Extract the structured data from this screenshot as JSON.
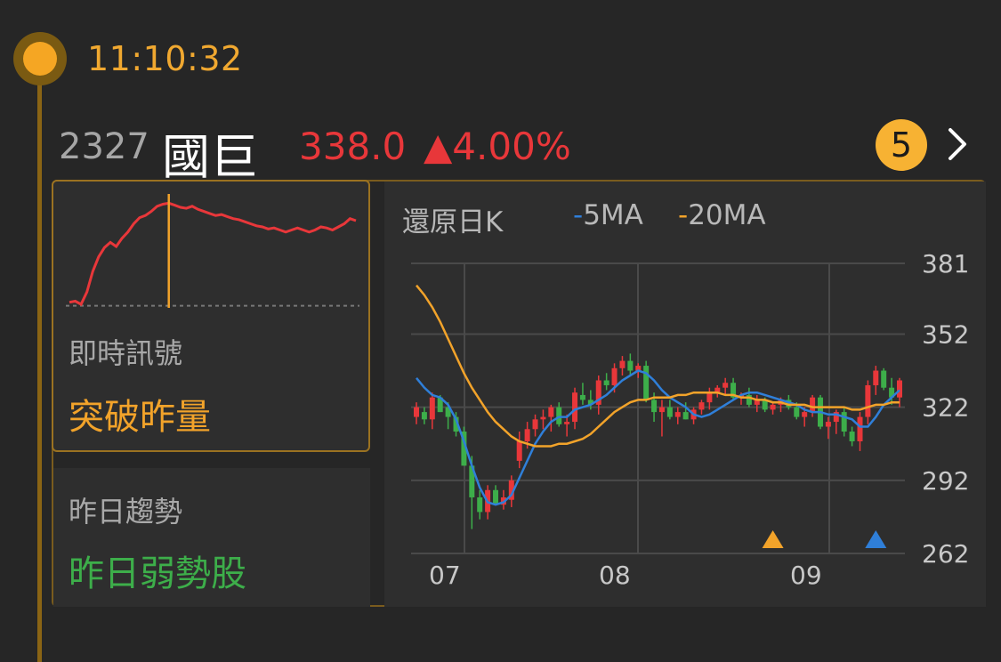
{
  "alert": {
    "time": "11:10:32"
  },
  "stock": {
    "code": "2327",
    "name": "國巨",
    "price": "338.0",
    "change": "▲4.00%",
    "badge_count": "5"
  },
  "signal": {
    "label": "即時訊號",
    "value": "突破昨量"
  },
  "trend": {
    "label": "昨日趨勢",
    "value": "昨日弱勢股"
  },
  "kchart": {
    "title": "還原日K",
    "ma5_label": "5MA",
    "ma20_label": "20MA",
    "dash": "-"
  },
  "colors": {
    "accent": "#f2a32a",
    "up": "#e8373a",
    "down": "#3dae4a",
    "ma5": "#2f7fd9",
    "ma20": "#f2a32a",
    "marker_blue": "#2f7fd9"
  },
  "chart_data": [
    {
      "type": "line",
      "name": "intraday",
      "x": [
        0,
        1,
        2,
        3,
        4,
        5,
        6,
        7,
        8,
        9,
        10,
        11,
        12,
        13,
        14,
        15,
        16,
        17,
        18,
        19,
        20,
        21,
        22,
        23,
        24,
        25,
        26,
        27,
        28,
        29,
        30,
        31,
        32,
        33,
        34,
        35,
        36,
        37,
        38,
        39,
        40,
        41,
        42,
        43,
        44,
        45,
        46,
        47,
        48,
        49
      ],
      "values": [
        0.02,
        0.03,
        0.0,
        0.12,
        0.32,
        0.46,
        0.55,
        0.6,
        0.56,
        0.64,
        0.7,
        0.78,
        0.84,
        0.86,
        0.9,
        0.95,
        0.97,
        0.98,
        0.96,
        0.94,
        0.93,
        0.95,
        0.92,
        0.9,
        0.88,
        0.86,
        0.87,
        0.85,
        0.83,
        0.82,
        0.8,
        0.78,
        0.76,
        0.75,
        0.73,
        0.74,
        0.72,
        0.7,
        0.72,
        0.74,
        0.72,
        0.7,
        0.72,
        0.75,
        0.74,
        0.72,
        0.75,
        0.78,
        0.83,
        0.81
      ],
      "reference_value": 0.02,
      "marker_index": 17
    },
    {
      "type": "candlestick",
      "title": "還原日K",
      "categories": [
        "07",
        "08",
        "09"
      ],
      "ylim": [
        262,
        381
      ],
      "yticks": [
        381,
        352,
        322,
        292,
        262
      ],
      "series": [
        {
          "name": "candles",
          "ohlc": [
            [
              318,
              324,
              315,
              322
            ],
            [
              320,
              322,
              315,
              317
            ],
            [
              317,
              328,
              313,
              326
            ],
            [
              326,
              327,
              320,
              320
            ],
            [
              322,
              324,
              313,
              318
            ],
            [
              318,
              320,
              310,
              312
            ],
            [
              312,
              314,
              298,
              298
            ],
            [
              298,
              302,
              272,
              285
            ],
            [
              285,
              288,
              276,
              279
            ],
            [
              279,
              290,
              276,
              288
            ],
            [
              288,
              290,
              282,
              282
            ],
            [
              282,
              288,
              280,
              285
            ],
            [
              284,
              294,
              281,
              292
            ],
            [
              300,
              312,
              297,
              308
            ],
            [
              308,
              316,
              305,
              313
            ],
            [
              313,
              319,
              310,
              317
            ],
            [
              317,
              321,
              313,
              318
            ],
            [
              318,
              323,
              312,
              322
            ],
            [
              322,
              324,
              314,
              315
            ],
            [
              315,
              319,
              310,
              316
            ],
            [
              316,
              330,
              313,
              328
            ],
            [
              327,
              332,
              323,
              325
            ],
            [
              325,
              329,
              321,
              323
            ],
            [
              323,
              335,
              319,
              333
            ],
            [
              333,
              336,
              329,
              331
            ],
            [
              331,
              340,
              328,
              338
            ],
            [
              338,
              343,
              335,
              341
            ],
            [
              341,
              344,
              335,
              337
            ],
            [
              337,
              340,
              334,
              339
            ],
            [
              339,
              341,
              324,
              325
            ],
            [
              325,
              328,
              316,
              320
            ],
            [
              320,
              325,
              310,
              322
            ],
            [
              322,
              325,
              317,
              318
            ],
            [
              318,
              322,
              315,
              320
            ],
            [
              320,
              324,
              317,
              317
            ],
            [
              317,
              322,
              315,
              321
            ],
            [
              321,
              325,
              319,
              324
            ],
            [
              324,
              330,
              321,
              328
            ],
            [
              328,
              331,
              326,
              330
            ],
            [
              330,
              334,
              327,
              332
            ],
            [
              332,
              334,
              325,
              326
            ],
            [
              326,
              328,
              323,
              327
            ],
            [
              327,
              330,
              322,
              323
            ],
            [
              323,
              327,
              320,
              325
            ],
            [
              325,
              326,
              320,
              321
            ],
            [
              321,
              324,
              319,
              323
            ],
            [
              323,
              326,
              320,
              325
            ],
            [
              325,
              327,
              321,
              322
            ],
            [
              322,
              324,
              317,
              318
            ],
            [
              318,
              322,
              314,
              320
            ],
            [
              320,
              327,
              318,
              326
            ],
            [
              326,
              327,
              313,
              314
            ],
            [
              314,
              318,
              309,
              316
            ],
            [
              316,
              321,
              311,
              320
            ],
            [
              320,
              322,
              310,
              312
            ],
            [
              312,
              314,
              306,
              308
            ],
            [
              308,
              320,
              304,
              318
            ],
            [
              318,
              333,
              315,
              331
            ],
            [
              331,
              339,
              327,
              337
            ],
            [
              337,
              338,
              329,
              330
            ],
            [
              330,
              334,
              323,
              326
            ],
            [
              326,
              334,
              322,
              333
            ]
          ]
        },
        {
          "name": "5MA",
          "values": [
            334,
            330,
            327,
            326,
            323,
            317,
            308,
            298,
            289,
            283,
            282,
            283,
            286,
            293,
            300,
            307,
            312,
            316,
            318,
            318,
            321,
            322,
            323,
            325,
            327,
            330,
            333,
            335,
            337,
            336,
            333,
            329,
            326,
            324,
            322,
            319,
            318,
            319,
            321,
            323,
            325,
            327,
            328,
            328,
            327,
            326,
            325,
            324,
            323,
            321,
            320,
            320,
            319,
            319,
            318,
            317,
            314,
            314,
            318,
            323,
            326,
            329
          ]
        },
        {
          "name": "20MA",
          "values": [
            372,
            368,
            363,
            357,
            350,
            343,
            336,
            330,
            325,
            320,
            316,
            313,
            310,
            308,
            307,
            306,
            306,
            306,
            307,
            307,
            308,
            309,
            311,
            314,
            317,
            320,
            322,
            324,
            325,
            325,
            326,
            326,
            326,
            327,
            327,
            328,
            328,
            328,
            328,
            327,
            327,
            326,
            326,
            325,
            325,
            324,
            324,
            323,
            323,
            323,
            322,
            322,
            322,
            322,
            322,
            321,
            321,
            322,
            323,
            323,
            324,
            324
          ]
        }
      ],
      "markers": [
        {
          "index": 45,
          "color": "#f2a32a"
        },
        {
          "index": 58,
          "color": "#2f7fd9"
        }
      ]
    }
  ]
}
